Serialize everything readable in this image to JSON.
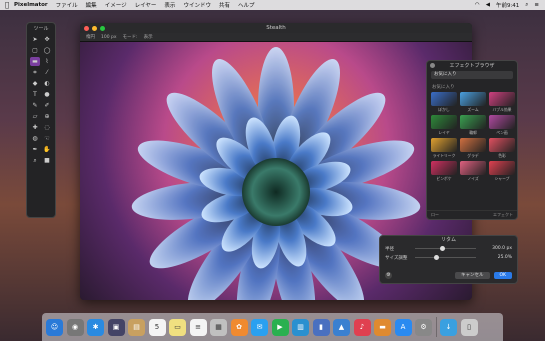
{
  "menubar": {
    "app_name": "Pixelmator",
    "items": [
      "ファイル",
      "編集",
      "イメージ",
      "レイヤー",
      "表示",
      "ウインドウ",
      "共有",
      "ヘルプ"
    ],
    "clock": "午前9:41"
  },
  "tools_palette": {
    "title": "ツール"
  },
  "window": {
    "title": "Stealth",
    "toolbar": [
      "楕円",
      "100 px",
      "モード:",
      "表示"
    ]
  },
  "effects_browser": {
    "title": "エフェクトブラウザ",
    "category_select": "お気に入り",
    "section_label": "お気に入り",
    "thumbnails": [
      {
        "label": "ぼかし",
        "color": "#3a6ec8"
      },
      {
        "label": "ズーム",
        "color": "#4aa0e0"
      },
      {
        "label": "バブル効果",
        "color": "#d04080"
      },
      {
        "label": "レイヤ",
        "color": "#2e8a3a"
      },
      {
        "label": "輪郭",
        "color": "#3aa050"
      },
      {
        "label": "ペン画",
        "color": "#b04aa0"
      },
      {
        "label": "ライトリーク",
        "color": "#e0a030"
      },
      {
        "label": "グラデ",
        "color": "#d07040"
      },
      {
        "label": "色彩",
        "color": "#e05060"
      },
      {
        "label": "ピンボケ",
        "color": "#d03060"
      },
      {
        "label": "ノイズ",
        "color": "#e06080"
      },
      {
        "label": "シャープ",
        "color": "#e04050"
      }
    ],
    "footer_left": "ロー",
    "footer_right": "エフェクト"
  },
  "dialog": {
    "title": "リタム",
    "params": [
      {
        "label": "半径",
        "value": "300.0 px",
        "level": 0.45
      },
      {
        "label": "サイズ調整",
        "value": "25.0%",
        "level": 0.35
      }
    ],
    "cancel_label": "キャンセル",
    "ok_label": "OK"
  },
  "dock": {
    "apps": [
      {
        "name": "finder-icon",
        "color": "#2a7ad8",
        "glyph": "☺"
      },
      {
        "name": "launchpad-icon",
        "color": "#777",
        "glyph": "◉"
      },
      {
        "name": "safari-icon",
        "color": "#2a8ae0",
        "glyph": "✱"
      },
      {
        "name": "photos-app-icon",
        "color": "#446",
        "glyph": "▣"
      },
      {
        "name": "notes-icon",
        "color": "#c8a060",
        "glyph": "▤"
      },
      {
        "name": "calendar-icon",
        "color": "#f4f4f4",
        "glyph": "5"
      },
      {
        "name": "stickies-icon",
        "color": "#f0e080",
        "glyph": "▭"
      },
      {
        "name": "reminders-icon",
        "color": "#f4f4f4",
        "glyph": "≡"
      },
      {
        "name": "preview-icon",
        "color": "#c0c0c0",
        "glyph": "▦"
      },
      {
        "name": "photo-booth-icon",
        "color": "#f08a30",
        "glyph": "✿"
      },
      {
        "name": "messages-icon",
        "color": "#2aa0f0",
        "glyph": "✉"
      },
      {
        "name": "facetime-icon",
        "color": "#2ab050",
        "glyph": "▶"
      },
      {
        "name": "numbers-icon",
        "color": "#2a90d0",
        "glyph": "▥"
      },
      {
        "name": "charts-icon",
        "color": "#4a70c0",
        "glyph": "▮"
      },
      {
        "name": "keynote-icon",
        "color": "#3a80d0",
        "glyph": "▲"
      },
      {
        "name": "music-icon",
        "color": "#e04050",
        "glyph": "♪"
      },
      {
        "name": "books-icon",
        "color": "#e08a30",
        "glyph": "▬"
      },
      {
        "name": "app-store-icon",
        "color": "#2a8af0",
        "glyph": "A"
      },
      {
        "name": "system-preferences-icon",
        "color": "#888",
        "glyph": "⚙"
      },
      {
        "name": "downloads-folder-icon",
        "color": "#3aa0e0",
        "glyph": "↓"
      },
      {
        "name": "trash-icon",
        "color": "#ccc",
        "glyph": "▯"
      }
    ]
  }
}
